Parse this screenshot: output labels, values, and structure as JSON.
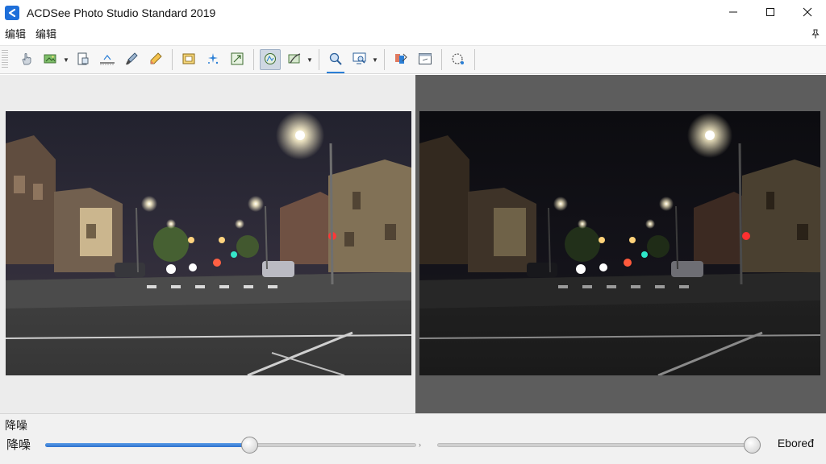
{
  "window": {
    "title": "ACDSee Photo Studio Standard 2019",
    "app_icon": "acdsee-logo-icon",
    "brand_color": "#1e6fd9",
    "controls": [
      "minimize-icon",
      "maximize-icon",
      "close-icon"
    ]
  },
  "menu": {
    "items": [
      "编辑",
      "编辑"
    ],
    "pin_icon": "pin-icon"
  },
  "toolbar": {
    "buttons": [
      {
        "icon": "hand-pointer-icon"
      },
      {
        "icon": "photo-tag-icon",
        "has_dropdown": true
      },
      {
        "icon": "rotate-page-icon"
      },
      {
        "icon": "straighten-icon"
      },
      {
        "icon": "brush-icon"
      },
      {
        "icon": "pencil-icon"
      },
      {
        "icon": "crop-frame-icon"
      },
      {
        "icon": "sparkle-icon"
      },
      {
        "icon": "resize-icon"
      },
      {
        "icon": "filter-icon",
        "active": true
      },
      {
        "icon": "brush-stroke-icon",
        "has_dropdown": true
      },
      {
        "icon": "zoom-icon",
        "underlined": true
      },
      {
        "icon": "monitor-icon",
        "has_dropdown": true
      },
      {
        "icon": "color-picker-icon"
      },
      {
        "icon": "window-icon"
      },
      {
        "icon": "selection-icon"
      }
    ]
  },
  "canvas": {
    "left_pane_bg": "#ececec",
    "right_pane_bg": "#5d5d5d",
    "left_image": "night-street-before",
    "right_image": "night-street-after"
  },
  "bottom_panel": {
    "section_label": "降噪",
    "slider_label": "降噪",
    "slider1_value": 0.55,
    "slider2_value": 1.0,
    "value_text": "Eboređ",
    "accent_color": "#2d72cf"
  }
}
